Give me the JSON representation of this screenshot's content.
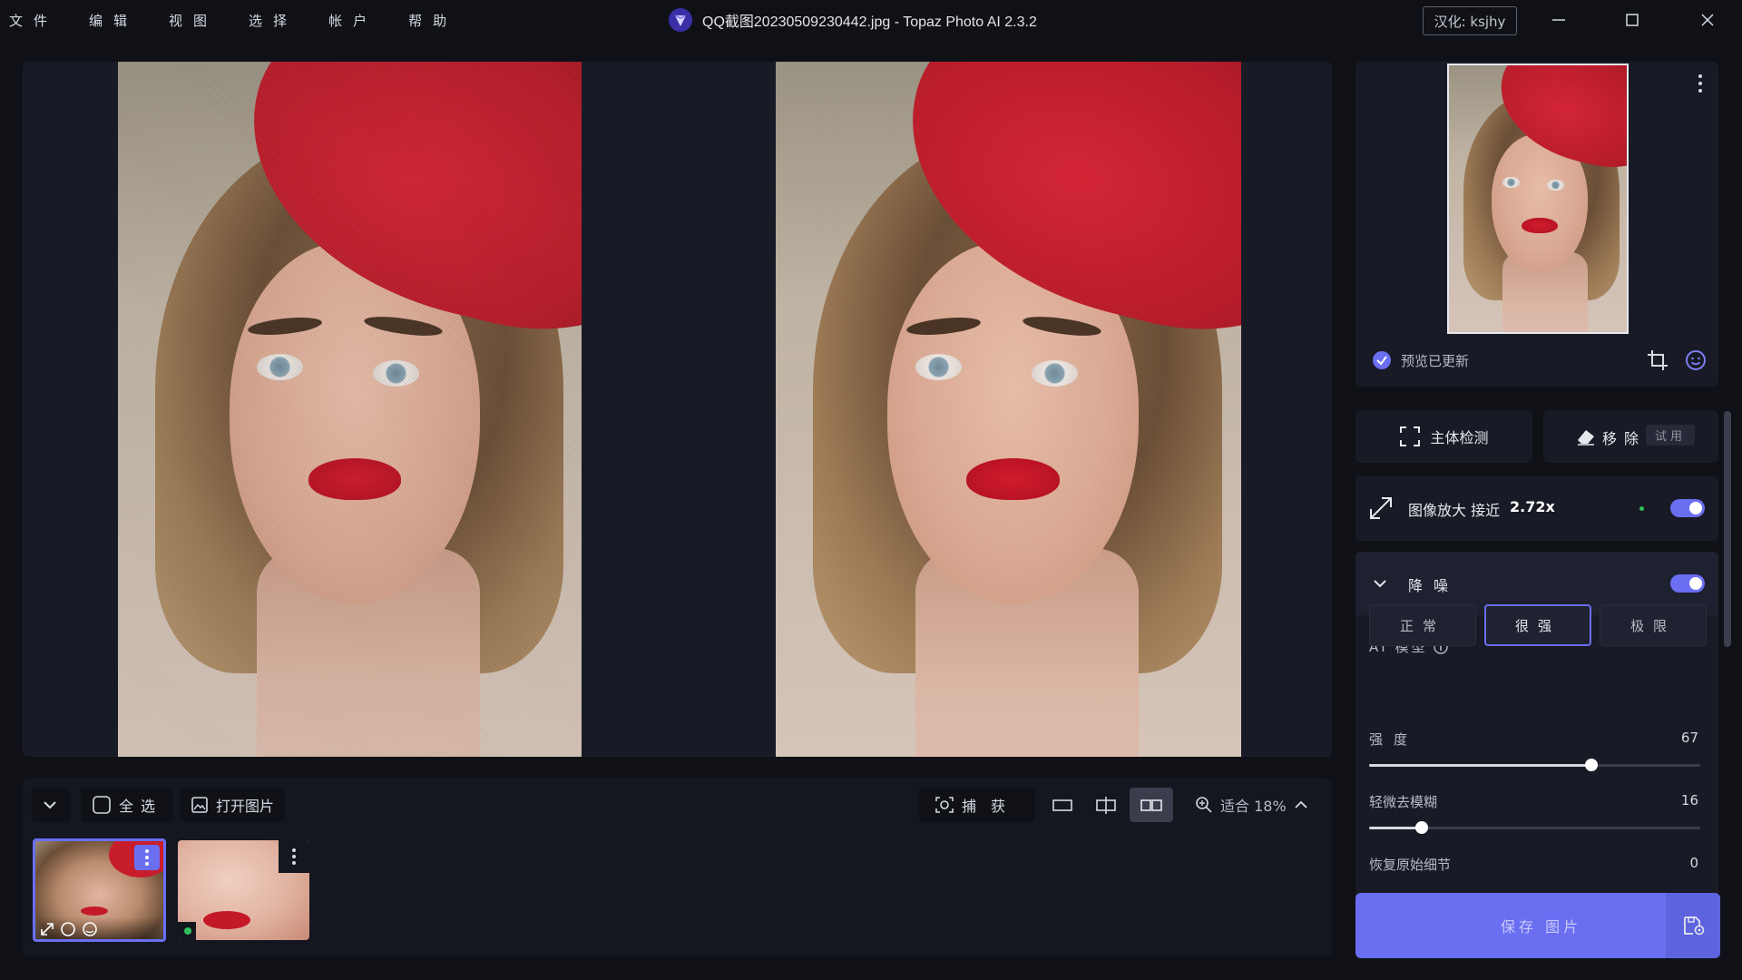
{
  "menu": [
    "文件",
    "编辑",
    "视图",
    "选择",
    "帐户",
    "帮助"
  ],
  "window": {
    "title": "QQ截图20230509230442.jpg - Topaz Photo AI 2.3.2",
    "hanhua": "汉化: ksjhy"
  },
  "filmstrip": {
    "select_all": "全选",
    "open_image": "打开图片"
  },
  "view_toolbar": {
    "capture": "捕获",
    "zoom": "适合 18%"
  },
  "navigator": {
    "status": "预览已更新"
  },
  "actions": {
    "subject_detect": "主体检测",
    "remove": "移除",
    "trial": "试用"
  },
  "upscale": {
    "label": "图像放大 接近",
    "factor": "2.72x",
    "enabled": true
  },
  "denoise": {
    "title": "降噪",
    "enabled": true,
    "ai_model_label": "AI 模型",
    "models": [
      "正常",
      "很强",
      "极限"
    ],
    "active_model": "很强",
    "sliders": [
      {
        "label": "强度",
        "value": 67
      },
      {
        "label": "轻微去模糊",
        "value": 16
      },
      {
        "label": "恢复原始细节",
        "value": 0
      }
    ]
  },
  "save": {
    "label": "保存 图片"
  },
  "colors": {
    "accent": "#6a6ff2",
    "panel": "#181a25",
    "background": "#101117"
  }
}
